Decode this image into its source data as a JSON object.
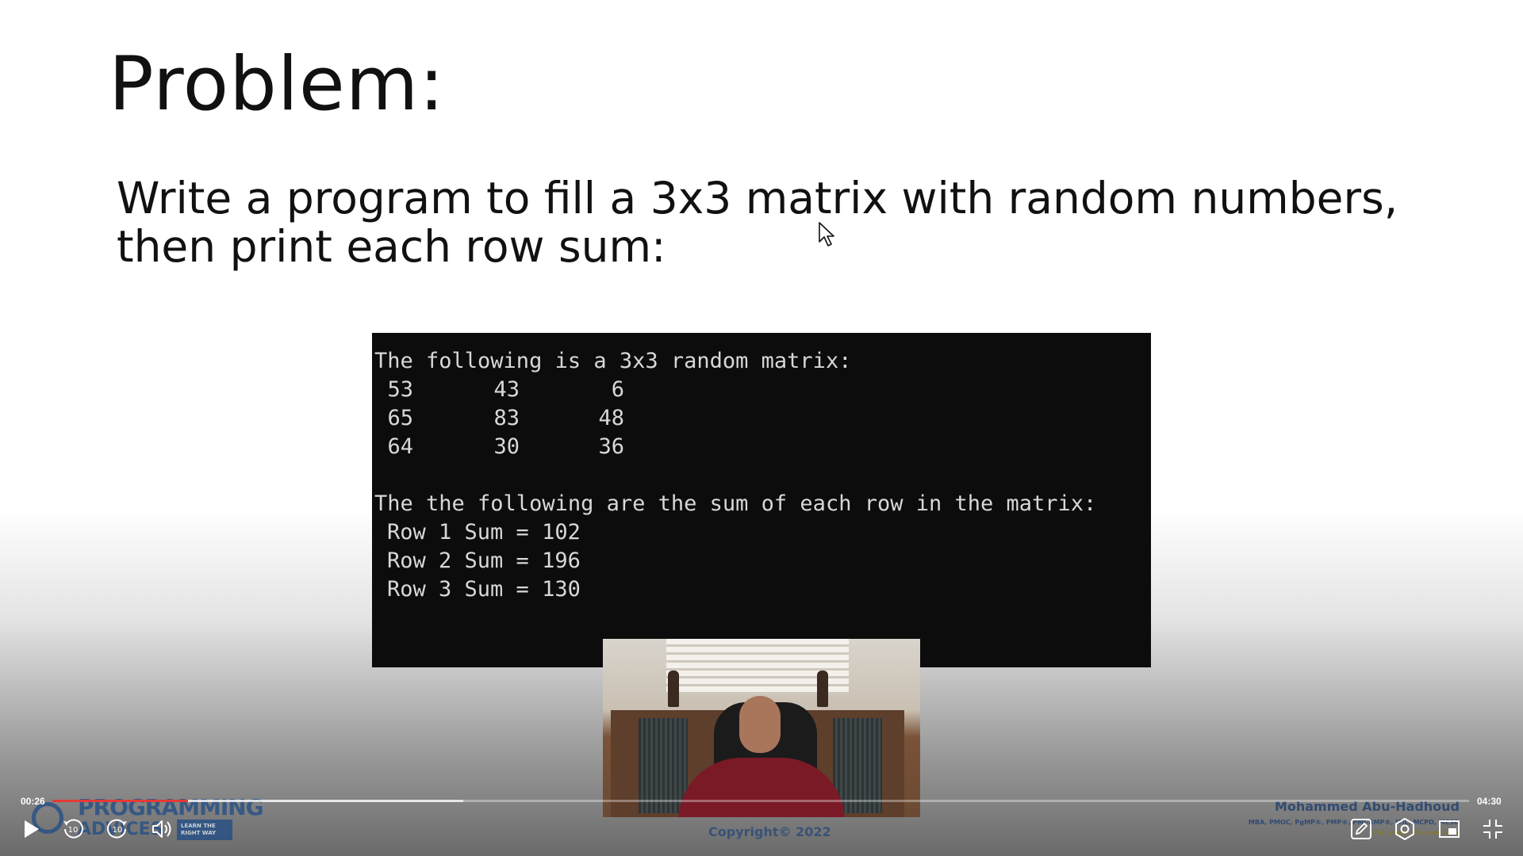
{
  "slide": {
    "title": "Problem:",
    "problem_lines": [
      "Write a program to fill a 3x3 matrix with random numbers,",
      "then print each row sum:"
    ]
  },
  "console": {
    "matrix_header": "The following is a 3x3 random matrix:",
    "matrix": [
      [
        "53",
        "43",
        "6"
      ],
      [
        "65",
        "83",
        "48"
      ],
      [
        "64",
        "30",
        "36"
      ]
    ],
    "sums_header": "The the following are the sum of each row in the matrix:",
    "sums": [
      "Row 1 Sum = 102",
      "Row 2 Sum = 196",
      "Row 3 Sum = 130"
    ]
  },
  "branding": {
    "logo_title": "PROGRAMMING",
    "logo_sub": "ADVICES",
    "logo_tag": "LEARN THE RIGHT WAY",
    "copyright": "Copyright© 2022",
    "author_name": "Mohammed Abu-Hadhoud",
    "author_creds": "MBA, PMOC, PgMP®, PMP®, PMI-RMP®, ITIL, MCPD, MCSD",
    "author_exp": "26+ years of experience"
  },
  "player": {
    "current_time": "00:26",
    "duration": "04:30",
    "progress_fraction": 0.096,
    "buffered_fraction": 0.29,
    "accent_color": "#e53935",
    "icons": [
      "play-icon",
      "rewind-10-icon",
      "forward-10-icon",
      "volume-icon",
      "pencil-icon",
      "settings-icon",
      "picture-in-picture-icon",
      "exit-fullscreen-icon"
    ]
  }
}
